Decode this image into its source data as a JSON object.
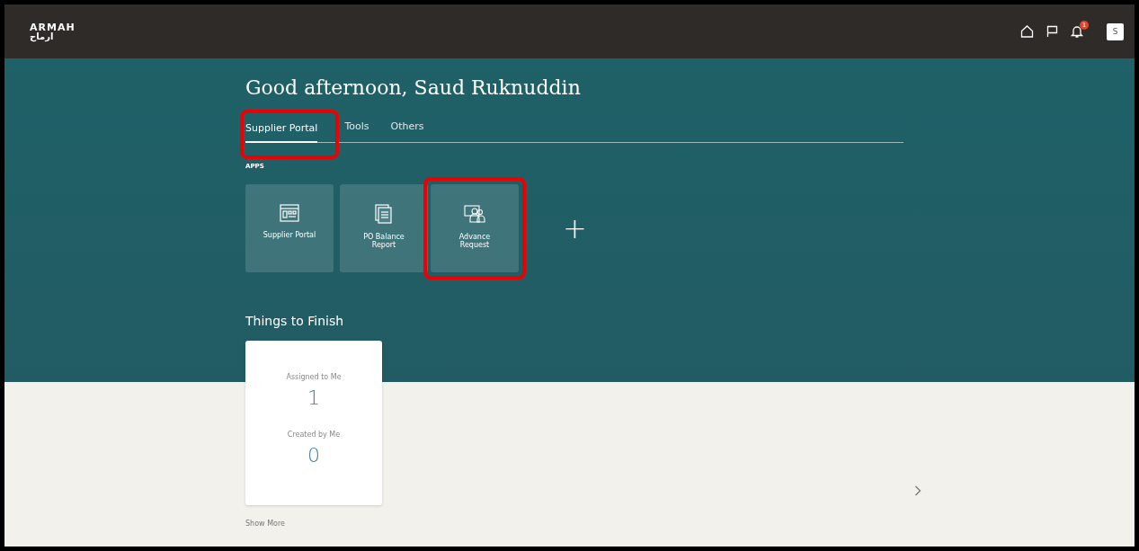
{
  "header": {
    "logo_latin": "ARMAH",
    "logo_arabic": "ارماح",
    "notification_count": "1",
    "avatar": "S"
  },
  "greeting": "Good afternoon, Saud Ruknuddin",
  "tabs": [
    {
      "label": "Supplier Portal",
      "selected": true,
      "highlighted": true
    },
    {
      "label": "Tools",
      "selected": false,
      "highlighted": false
    },
    {
      "label": "Others",
      "selected": false,
      "highlighted": false
    }
  ],
  "apps_heading": "APPS",
  "apps": [
    {
      "kind": "portal",
      "label": "Supplier Portal",
      "highlighted": false
    },
    {
      "kind": "report",
      "label": "PO Balance Report",
      "highlighted": false
    },
    {
      "kind": "people",
      "label": "Advance Request",
      "highlighted": true
    }
  ],
  "add_label": "+",
  "things_to_finish": {
    "title": "Things to Finish",
    "metrics": [
      {
        "label": "Assigned to Me",
        "value": "1"
      },
      {
        "label": "Created by Me",
        "value": "0"
      }
    ],
    "show_more": "Show More"
  }
}
